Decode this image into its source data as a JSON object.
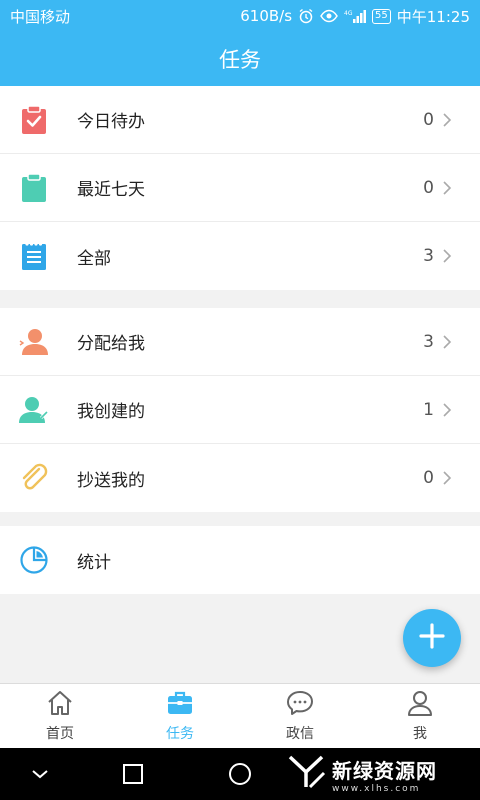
{
  "status_bar": {
    "carrier": "中国移动",
    "speed": "610B/s",
    "battery": "55",
    "time": "中午11:25"
  },
  "app_bar": {
    "title": "任务"
  },
  "groups": [
    {
      "items": [
        {
          "label": "今日待办",
          "count": "0",
          "icon": "clipboard-check-icon",
          "color": "#ef6a6a"
        },
        {
          "label": "最近七天",
          "count": "0",
          "icon": "clipboard-icon",
          "color": "#4ecdb3"
        },
        {
          "label": "全部",
          "count": "3",
          "icon": "notepad-icon",
          "color": "#2fa6e8"
        }
      ]
    },
    {
      "items": [
        {
          "label": "分配给我",
          "count": "3",
          "icon": "user-assigned-icon",
          "color": "#f3906b"
        },
        {
          "label": "我创建的",
          "count": "1",
          "icon": "user-created-icon",
          "color": "#4ecdb3"
        },
        {
          "label": "抄送我的",
          "count": "0",
          "icon": "paperclip-icon",
          "color": "#f0c25a"
        }
      ]
    },
    {
      "items": [
        {
          "label": "统计",
          "count": "",
          "icon": "pie-chart-icon",
          "color": "#2fa6e8"
        }
      ]
    }
  ],
  "fab": {
    "icon": "plus-icon"
  },
  "tabs": [
    {
      "label": "首页",
      "icon": "home-icon",
      "active": false
    },
    {
      "label": "任务",
      "icon": "briefcase-icon",
      "active": true
    },
    {
      "label": "政信",
      "icon": "chat-bubble-icon",
      "active": false
    },
    {
      "label": "我",
      "icon": "person-icon",
      "active": false
    }
  ],
  "watermark": {
    "text": "新绿资源网",
    "sub": "www.xlhs.com"
  },
  "colors": {
    "accent": "#3cb8f3",
    "background": "#f2f2f2"
  }
}
